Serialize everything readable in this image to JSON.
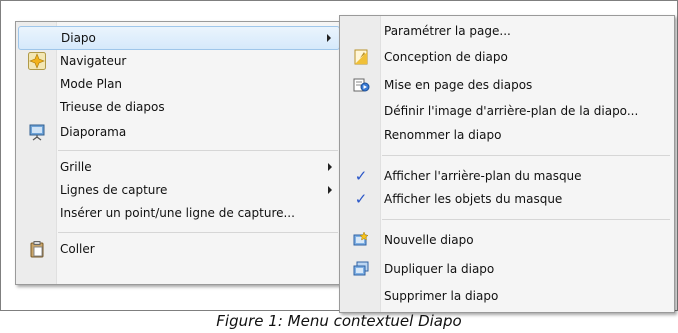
{
  "menu": {
    "items": [
      {
        "label": "Diapo"
      },
      {
        "label": "Navigateur"
      },
      {
        "label": "Mode Plan"
      },
      {
        "label": "Trieuse de diapos"
      },
      {
        "label": "Diaporama"
      },
      {
        "label": "Grille"
      },
      {
        "label": "Lignes de capture"
      },
      {
        "label": "Insérer un point/une ligne de capture..."
      },
      {
        "label": "Coller"
      }
    ]
  },
  "submenu": {
    "items": [
      {
        "label": "Paramétrer la page..."
      },
      {
        "label": "Conception de diapo"
      },
      {
        "label": "Mise en page des diapos"
      },
      {
        "label": "Définir l'image d'arrière-plan de la diapo..."
      },
      {
        "label": "Renommer la diapo"
      },
      {
        "label": "Afficher l'arrière-plan du masque"
      },
      {
        "label": "Afficher les objets du masque"
      },
      {
        "label": "Nouvelle diapo"
      },
      {
        "label": "Dupliquer la diapo"
      },
      {
        "label": "Supprimer la diapo"
      }
    ],
    "check_glyph": "✓"
  },
  "caption": "Figure 1: Menu contextuel Diapo",
  "icons": [
    "navigator-icon",
    "slideshow-icon",
    "paste-icon",
    "slide-design-icon",
    "slide-layout-icon",
    "new-slide-icon",
    "duplicate-slide-icon"
  ],
  "colors": {
    "highlight_border": "#9fc6ea",
    "check": "#2b57c8"
  }
}
